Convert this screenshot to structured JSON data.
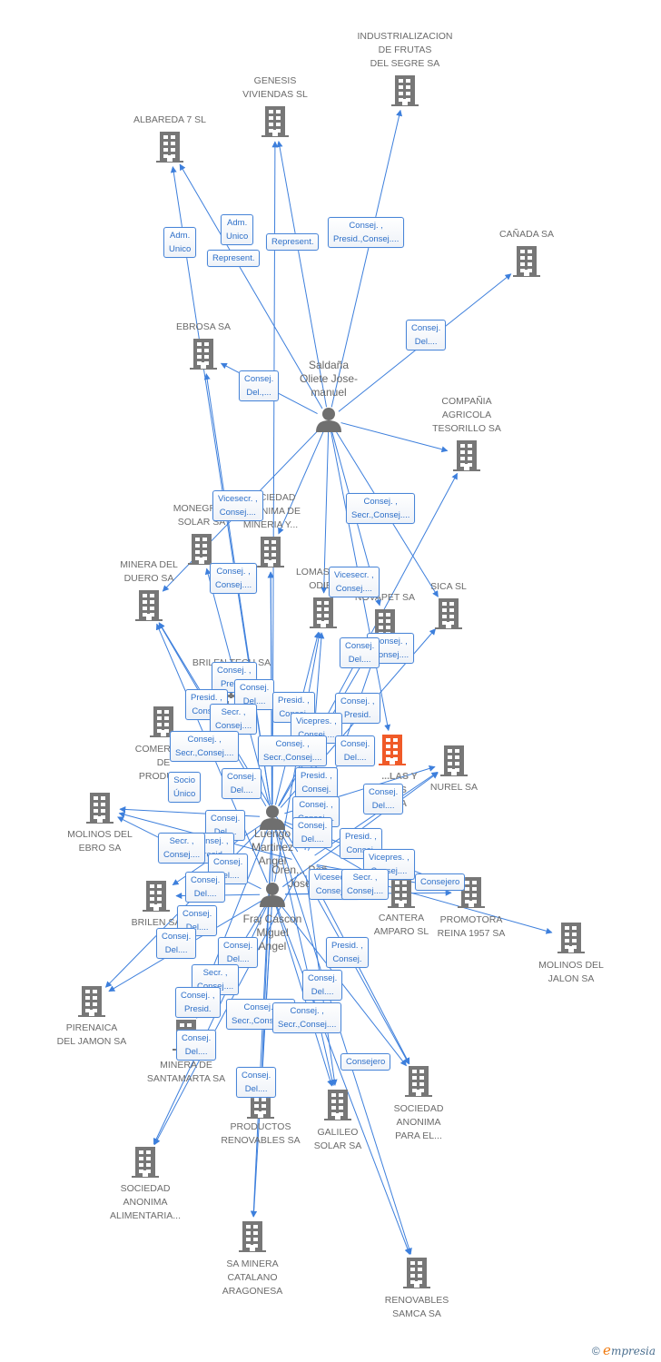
{
  "colors": {
    "edge": "#3d7fdc",
    "company": "#777777",
    "focus_company": "#f05a28",
    "person": "#6f6f6f",
    "role_text": "#2d6fc8"
  },
  "companies": [
    {
      "id": "c1",
      "label": "INDUSTRIALIZACION\nDE FRUTAS\nDEL SEGRE SA"
    },
    {
      "id": "c2",
      "label": "GENESIS\nVIVIENDAS SL"
    },
    {
      "id": "c3",
      "label": "ALBAREDA 7 SL"
    },
    {
      "id": "c4",
      "label": "CAÑADA SA"
    },
    {
      "id": "c5",
      "label": "EBROSA SA"
    },
    {
      "id": "c6",
      "label": "COMPAÑIA\nAGRICOLA\nTESORILLO SA"
    },
    {
      "id": "c7",
      "label": "MONEGROS\nSOLAR SA"
    },
    {
      "id": "c8",
      "label": "SOCIEDAD\nANONIMA DE\nMINERIA Y..."
    },
    {
      "id": "c9",
      "label": "MINERA DEL\nDUERO SA"
    },
    {
      "id": "c10",
      "label": "LOMAS DEL\nODIEL"
    },
    {
      "id": "c11",
      "label": "NOVAPET SA"
    },
    {
      "id": "c12",
      "label": "SICA SL"
    },
    {
      "id": "c13",
      "label": "BRILEN TECH SA"
    },
    {
      "id": "c14",
      "label": "COMERCIAL\nDE\nPRODUC..."
    },
    {
      "id": "c15",
      "label": "...LAS Y\n...S\n...A",
      "focus": true
    },
    {
      "id": "c16",
      "label": "NUREL SA"
    },
    {
      "id": "c17",
      "label": "MOLINOS DEL\nEBRO SA"
    },
    {
      "id": "c18",
      "label": "BRILEN SA"
    },
    {
      "id": "c19",
      "label": "CANTERA\nAMPARO SL"
    },
    {
      "id": "c20",
      "label": "PROMOTORA\nREINA 1957 SA"
    },
    {
      "id": "c21",
      "label": "MOLINOS DEL\nJALON SA"
    },
    {
      "id": "c22",
      "label": "PIRENAICA\nDEL JAMON SA"
    },
    {
      "id": "c23",
      "label": "MINERA DE\nSANTAMARTA SA"
    },
    {
      "id": "c24",
      "label": "PRODUCTOS\nRENOVABLES SA"
    },
    {
      "id": "c25",
      "label": "GALILEO\nSOLAR SA"
    },
    {
      "id": "c26",
      "label": "SOCIEDAD\nANONIMA\nPARA EL..."
    },
    {
      "id": "c27",
      "label": "SOCIEDAD\nANONIMA\nALIMENTARIA..."
    },
    {
      "id": "c28",
      "label": "SA MINERA\nCATALANO\nARAGONESA"
    },
    {
      "id": "c29",
      "label": "RENOVABLES\nSAMCA SA"
    }
  ],
  "persons": [
    {
      "id": "p1",
      "label": "Saldaña\nOliete Jose-\nmanuel"
    },
    {
      "id": "p2",
      "label": "Luengo\nMartinez\nAngel"
    },
    {
      "id": "p3",
      "label": "Oren... Peñ...\nJose..."
    },
    {
      "id": "p4",
      "label": "Fraj Cascon\nMiguel\nAngel"
    }
  ],
  "edges": [
    [
      "p1",
      "c1"
    ],
    [
      "p1",
      "c2"
    ],
    [
      "p1",
      "c3"
    ],
    [
      "p1",
      "c4"
    ],
    [
      "p1",
      "c5"
    ],
    [
      "p1",
      "c6"
    ],
    [
      "p1",
      "c9"
    ],
    [
      "p1",
      "c12"
    ],
    [
      "p1",
      "c10"
    ],
    [
      "p1",
      "c11"
    ],
    [
      "p1",
      "c15"
    ],
    [
      "p1",
      "c8"
    ],
    [
      "p2",
      "c3"
    ],
    [
      "p2",
      "c2"
    ],
    [
      "p2",
      "c5"
    ],
    [
      "p2",
      "c7"
    ],
    [
      "p2",
      "c8"
    ],
    [
      "p2",
      "c9"
    ],
    [
      "p2",
      "c10"
    ],
    [
      "p2",
      "c11"
    ],
    [
      "p2",
      "c12"
    ],
    [
      "p2",
      "c6"
    ],
    [
      "p2",
      "c16"
    ],
    [
      "p2",
      "c17"
    ],
    [
      "p2",
      "c18"
    ],
    [
      "p2",
      "c19"
    ],
    [
      "p2",
      "c20"
    ],
    [
      "p2",
      "c22"
    ],
    [
      "p2",
      "c23"
    ],
    [
      "p2",
      "c24"
    ],
    [
      "p2",
      "c25"
    ],
    [
      "p2",
      "c26"
    ],
    [
      "p2",
      "c28"
    ],
    [
      "p2",
      "c29"
    ],
    [
      "p3",
      "c16"
    ],
    [
      "p3",
      "c20"
    ],
    [
      "p3",
      "c21"
    ],
    [
      "p3",
      "c17"
    ],
    [
      "p3",
      "c9"
    ],
    [
      "p3",
      "c10"
    ],
    [
      "p3",
      "c11"
    ],
    [
      "p3",
      "c27"
    ],
    [
      "p3",
      "c25"
    ],
    [
      "p3",
      "c26"
    ],
    [
      "p4",
      "c17"
    ],
    [
      "p4",
      "c18"
    ],
    [
      "p4",
      "c22"
    ],
    [
      "p4",
      "c23"
    ],
    [
      "p4",
      "c24"
    ],
    [
      "p4",
      "c25"
    ],
    [
      "p4",
      "c26"
    ],
    [
      "p4",
      "c27"
    ],
    [
      "p4",
      "c28"
    ],
    [
      "p4",
      "c29"
    ],
    [
      "p4",
      "c16"
    ],
    [
      "p4",
      "c19"
    ],
    [
      "p4",
      "c20"
    ],
    [
      "p4",
      "c10"
    ],
    [
      "p4",
      "c8"
    ],
    [
      "p4",
      "c9"
    ]
  ],
  "roles": [
    "Adm.\nUnico",
    "Adm.\nUnico",
    "Represent.",
    "Represent.",
    "Consej. ,\nPresid.,Consej....",
    "Consej.\nDel....",
    "Consej.\nDel.,...",
    "Vicesecr. ,\nConsej....",
    "Consej. ,\nSecr.,Consej....",
    "Vicesecr. ,\nConsej....",
    "Consej. ,\nConsej....",
    "Consej. ,\nConsej....",
    "Consej.\nDel....",
    "Consej. ,\nPresid.",
    "Presid. ,\nConsej.",
    "Consej.\nDel....",
    "Presid. ,\nConsej.",
    "Consej. ,\nPresid.",
    "Secr. ,\nConsej....",
    "Vicepres. ,\nConsej....",
    "Consej. ,\nSecr.,Consej....",
    "Consej. ,\nSecr.,Consej....",
    "Consej.\nDel....",
    "Socio\nÚnico",
    "Consej.\nDel....",
    "Presid. ,\nConsej.",
    "Consej.\nDel....",
    "Consej. ,\nConsej....",
    "Consej.\nDel....",
    "Consej.\nDel....",
    "Consej. ,\nPresid.",
    "Presid. ,\nConsej.",
    "Secr. ,\nConsej....",
    "Consej.\nDel....",
    "Vicepres. ,\nConsej....",
    "Consej.\nDel....",
    "Vicesecr. ,\nConsej....",
    "Secr. ,\nConsej....",
    "Consejero",
    "Consej.\nDel....",
    "Consej.\nDel....",
    "Consej.\nDel....",
    "Presid. ,\nConsej.",
    "Secr. ,\nConsej....",
    "Consej. ,\nPresid.",
    "Consej.\nDel....",
    "Consej. ,\nSecr.,Consej....",
    "Consej. ,\nSecr.,Consej....",
    "Consej.\nDel....",
    "Consej.\nDel....",
    "Consejero"
  ],
  "footer": {
    "copyright": "©",
    "brand_initial": "e",
    "brand_rest": "mpresia"
  }
}
